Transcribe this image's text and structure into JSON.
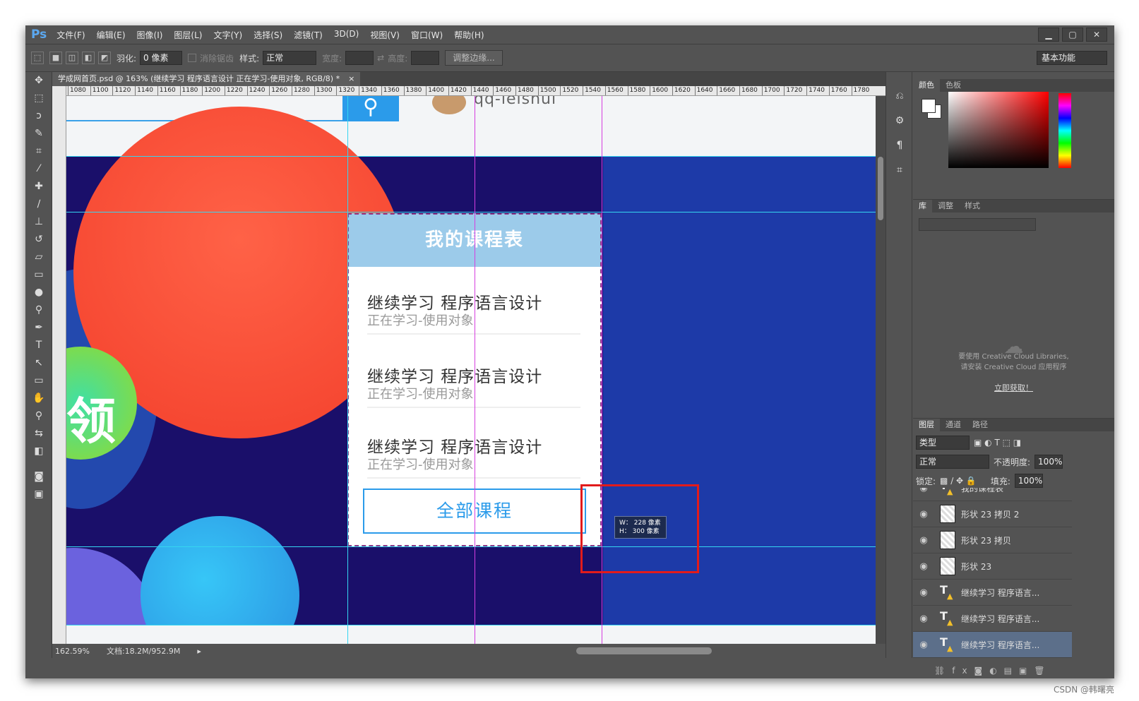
{
  "app": {
    "logo": "Ps"
  },
  "menu": [
    "文件(F)",
    "编辑(E)",
    "图像(I)",
    "图层(L)",
    "文字(Y)",
    "选择(S)",
    "滤镜(T)",
    "3D(D)",
    "视图(V)",
    "窗口(W)",
    "帮助(H)"
  ],
  "options": {
    "feather_label": "羽化:",
    "feather_value": "0 像素",
    "antialias_label": "消除锯齿",
    "style_label": "样式:",
    "style_value": "正常",
    "width_label": "宽度:",
    "height_label": "高度:",
    "refine_edge": "调整边缘...",
    "workspace": "基本功能"
  },
  "document": {
    "tab_title": "学成网首页.psd @ 163% (继续学习 程序语言设计 正在学习-使用对象, RGB/8) *",
    "close_glyph": "×"
  },
  "ruler_ticks": [
    "1080",
    "1100",
    "1120",
    "1140",
    "1160",
    "1180",
    "1200",
    "1220",
    "1240",
    "1260",
    "1280",
    "1300",
    "1320",
    "1340",
    "1360",
    "1380",
    "1400",
    "1420",
    "1440",
    "1460",
    "1480",
    "1500",
    "1520",
    "1540",
    "1560",
    "1580",
    "1600",
    "1620",
    "1640",
    "1660",
    "1680",
    "1700",
    "1720",
    "1740",
    "1760",
    "1780"
  ],
  "canvas": {
    "username": "qq-leishui",
    "banner_char": "领",
    "card_title": "我的课程表",
    "courses": [
      {
        "title": "继续学习 程序语言设计",
        "subtitle": "正在学习-使用对象"
      },
      {
        "title": "继续学习 程序语言设计",
        "subtitle": "正在学习-使用对象"
      },
      {
        "title": "继续学习 程序语言设计",
        "subtitle": "正在学习-使用对象"
      }
    ],
    "all_courses_button": "全部课程",
    "tooltip_w": "W： 228 像素",
    "tooltip_h": "H： 300 像素"
  },
  "status": {
    "zoom": "162.59%",
    "doc": "文档:18.2M/952.9M"
  },
  "panels": {
    "color_tabs": [
      "颜色",
      "色板"
    ],
    "library_tabs": [
      "库",
      "调整",
      "样式"
    ],
    "cc_message_1": "要使用 Creative Cloud Libraries,",
    "cc_message_2": "请安装 Creative Cloud 应用程序",
    "cc_link": "立即获取！",
    "layer_tabs": [
      "图层",
      "通道",
      "路径"
    ],
    "filter_kind": "类型",
    "blend_mode": "正常",
    "opacity_label": "不透明度:",
    "opacity_value": "100%",
    "lock_label": "锁定:",
    "fill_label": "填充:",
    "fill_value": "100%"
  },
  "layers": [
    {
      "name": "我的课程表",
      "type": "text"
    },
    {
      "name": "形状 23 拷贝 2",
      "type": "shape"
    },
    {
      "name": "形状 23 拷贝",
      "type": "shape"
    },
    {
      "name": "形状 23",
      "type": "shape"
    },
    {
      "name": "继续学习 程序语言...",
      "type": "text"
    },
    {
      "name": "继续学习 程序语言...",
      "type": "text"
    },
    {
      "name": "继续学习 程序语言...",
      "type": "text",
      "selected": true
    }
  ],
  "watermark": "CSDN @韩曙亮",
  "colors": {
    "accent": "#2b9bea",
    "banner": "#1a0f6a",
    "canvas_bg": "#1d3aa8",
    "selection_red": "#e21b1b"
  }
}
